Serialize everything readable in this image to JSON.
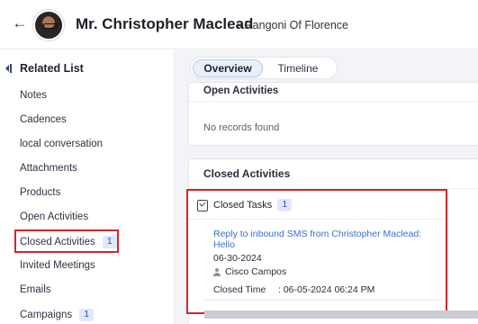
{
  "header": {
    "back_icon": "arrow-left-icon",
    "contact_name": "Mr. Christopher Maclead",
    "company": "- Rangoni Of Florence"
  },
  "sidebar": {
    "title": "Related List",
    "items": [
      {
        "label": "Notes"
      },
      {
        "label": "Cadences"
      },
      {
        "label": "local conversation"
      },
      {
        "label": "Attachments"
      },
      {
        "label": "Products"
      },
      {
        "label": "Open Activities"
      },
      {
        "label": "Closed Activities",
        "count": "1"
      },
      {
        "label": "Invited Meetings"
      },
      {
        "label": "Emails"
      },
      {
        "label": "Campaigns",
        "count": "1"
      }
    ]
  },
  "main": {
    "tabs": [
      {
        "label": "Overview",
        "active": true
      },
      {
        "label": "Timeline",
        "active": false
      }
    ],
    "open_activities": {
      "title": "Open Activities",
      "empty_text": "No records found"
    },
    "closed_activities": {
      "title": "Closed Activities",
      "tasks_label": "Closed Tasks",
      "tasks_count": "1",
      "task": {
        "subject": "Reply to inbound SMS from Christopher Maclead: Hello",
        "date": "06-30-2024",
        "owner": "Cisco Campos",
        "closed_time_label": "Closed Time",
        "closed_time_value": ": 06-05-2024 06:24 PM"
      }
    }
  },
  "colors": {
    "highlight": "#d8232a",
    "link": "#3a6fd0",
    "badge_bg": "#dfe8fb"
  }
}
